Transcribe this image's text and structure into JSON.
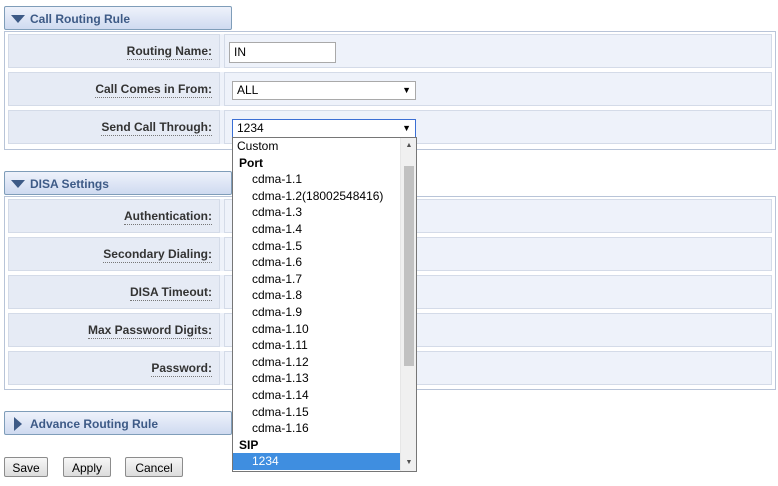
{
  "sections": {
    "call_routing": {
      "title": "Call Routing Rule",
      "fields": {
        "routing_name": {
          "label": "Routing Name:",
          "value": "IN"
        },
        "call_comes_in_from": {
          "label": "Call Comes in From:",
          "value": "ALL"
        },
        "send_call_through": {
          "label": "Send Call Through:",
          "value": "1234"
        }
      }
    },
    "disa": {
      "title": "DISA Settings",
      "fields": {
        "authentication": {
          "label": "Authentication:"
        },
        "secondary_dialing": {
          "label": "Secondary Dialing:"
        },
        "disa_timeout": {
          "label": "DISA Timeout:"
        },
        "max_password_digits": {
          "label": "Max Password Digits:"
        },
        "password": {
          "label": "Password:"
        }
      }
    },
    "advance": {
      "title": "Advance Routing Rule"
    }
  },
  "dropdown": {
    "options": [
      {
        "label": "Custom",
        "kind": "option"
      },
      {
        "label": "Port",
        "kind": "group"
      },
      {
        "label": "cdma-1.1",
        "kind": "child"
      },
      {
        "label": "cdma-1.2(18002548416)",
        "kind": "child"
      },
      {
        "label": "cdma-1.3",
        "kind": "child"
      },
      {
        "label": "cdma-1.4",
        "kind": "child"
      },
      {
        "label": "cdma-1.5",
        "kind": "child"
      },
      {
        "label": "cdma-1.6",
        "kind": "child"
      },
      {
        "label": "cdma-1.7",
        "kind": "child"
      },
      {
        "label": "cdma-1.8",
        "kind": "child"
      },
      {
        "label": "cdma-1.9",
        "kind": "child"
      },
      {
        "label": "cdma-1.10",
        "kind": "child"
      },
      {
        "label": "cdma-1.11",
        "kind": "child"
      },
      {
        "label": "cdma-1.12",
        "kind": "child"
      },
      {
        "label": "cdma-1.13",
        "kind": "child"
      },
      {
        "label": "cdma-1.14",
        "kind": "child"
      },
      {
        "label": "cdma-1.15",
        "kind": "child"
      },
      {
        "label": "cdma-1.16",
        "kind": "child"
      },
      {
        "label": "SIP",
        "kind": "group"
      },
      {
        "label": "1234",
        "kind": "child",
        "selected": true
      }
    ]
  },
  "buttons": {
    "save": "Save",
    "apply": "Apply",
    "cancel": "Cancel"
  },
  "icons": {
    "expanded": "triangle-down-icon",
    "collapsed": "triangle-right-icon",
    "select_arrow": "dropdown-arrow-icon"
  },
  "colors": {
    "header_text": "#3d5a86",
    "selected_option": "#3f8ee0",
    "row_background": "#eef2fa"
  }
}
